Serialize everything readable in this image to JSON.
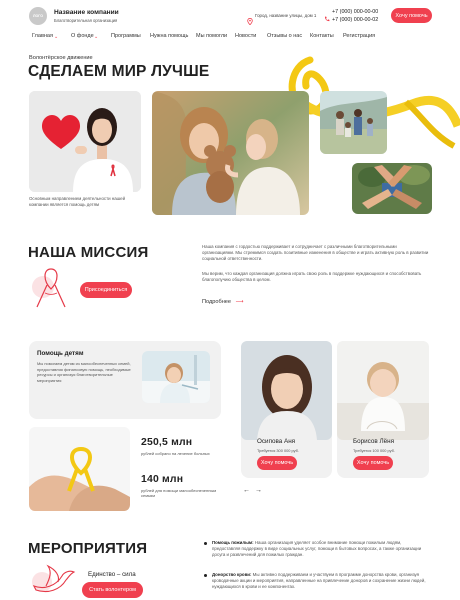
{
  "header": {
    "logo_text": "ЛОГО",
    "company_name": "Название компании",
    "company_sub": "Благотворительная организация",
    "address": "Город, название улицы, дом 1",
    "phone1": "+7 (000) 000-00-00",
    "phone2": "+7 (000) 000-00-02",
    "help_button": "Хочу помочь"
  },
  "nav": {
    "items": [
      "Главная",
      "О фонде",
      "Программы",
      "Нужна помощь",
      "Мы помогли",
      "Новости",
      "Отзывы о нас",
      "Контакты",
      "Регистрация"
    ]
  },
  "hero": {
    "kicker": "Волонтёрское движение",
    "title": "СДЕЛАЕМ МИР ЛУЧШЕ",
    "caption": "Основным направлением деятельности нашей компании является помощь детям"
  },
  "mission": {
    "title": "НАША МИССИЯ",
    "button": "Присоединиться",
    "para1": "Наша компания с гордостью поддерживает и сотрудничает с различными благотворительными организациями. Мы стремимся создать позитивные изменения в обществе и играть активную роль в развитии социальной ответственности.",
    "para2": "Мы верим, что каждая организация должна играть свою роль в поддержке нуждающихся и способствовать благополучию общества в целом.",
    "more_link": "Подробнее"
  },
  "help": {
    "title": "Помощь детям",
    "text": "Мы помогаем детям из малообеспеченных семей, предоставляя финансовую помощь, необходимые ресурсы и организуя благотворительные мероприятия",
    "stat1_value": "250,5 млн",
    "stat1_label": "рублей собрано на лечение больных",
    "stat2_value": "140 млн",
    "stat2_label": "рублей для помощи малообеспеченным семьям",
    "children": [
      {
        "name": "Осипова Аня",
        "need": "Требуется 300 000 руб.",
        "button": "Хочу помочь"
      },
      {
        "name": "Борисов Лёня",
        "need": "Требуется 100 000 руб.",
        "button": "Хочу помочь"
      }
    ]
  },
  "events": {
    "title": "МЕРОПРИЯТИЯ",
    "motto": "Единство – сила",
    "button": "Стать волонтером",
    "item1_title": "Помощь пожилым:",
    "item1_text": " Наша организация уделяет особое внимание помощи пожилым людям, предоставляя поддержку в виде социальных услуг, помощи в бытовых вопросах, а также организации досуга и развлечений для пожилых граждан.",
    "item2_title": "Донорство крови:",
    "item2_text": " Мы активно поддерживаем и участвуем в программе донорства крови, организуя кроводачные акции и мероприятия, направленные на привлечение доноров и сохранение жизни людей, нуждающихся в крови и ее компонентах."
  },
  "colors": {
    "accent": "#f0404f",
    "ribbon": "#f3c814"
  }
}
